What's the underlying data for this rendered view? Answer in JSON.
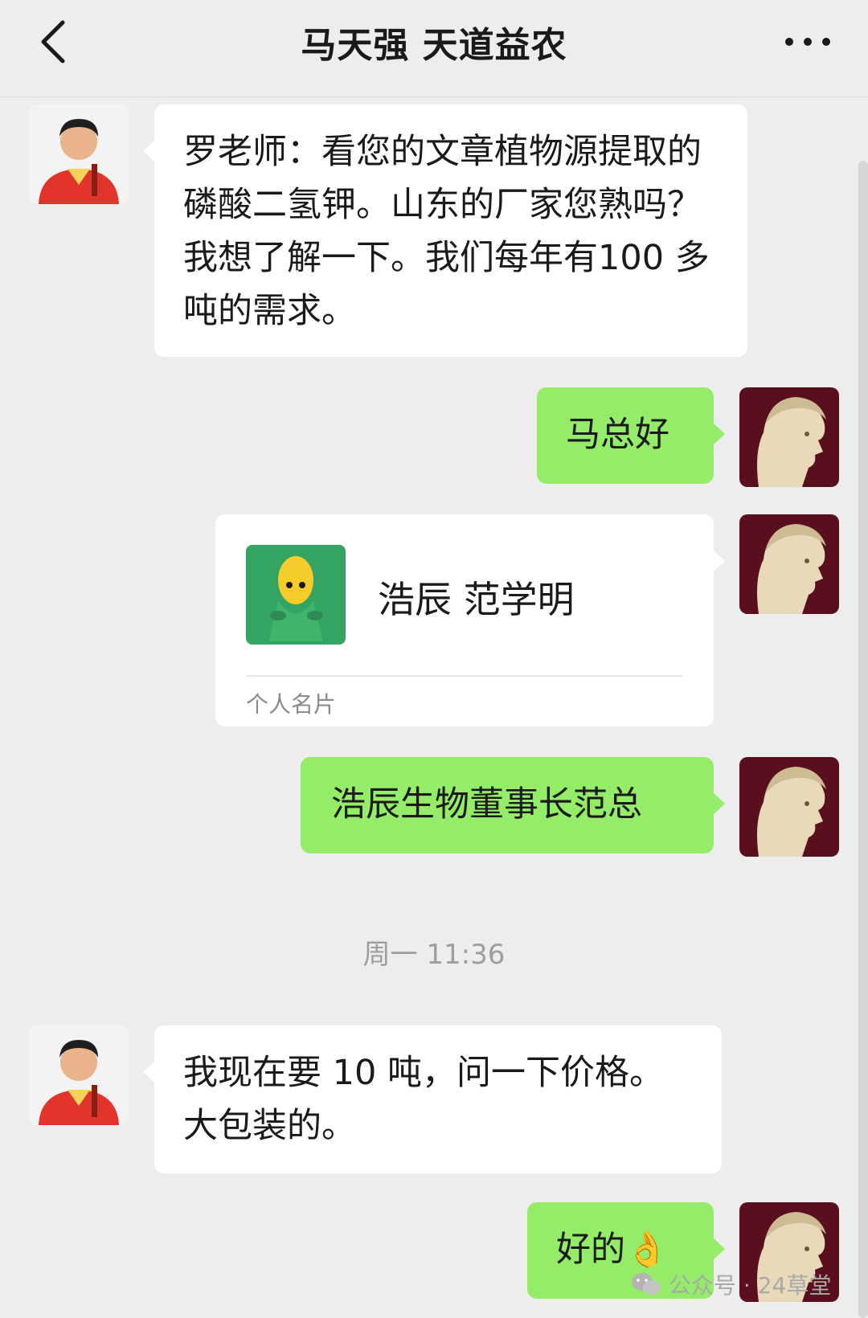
{
  "header": {
    "title": "马天强  天道益农",
    "back_icon": "chevron-left-icon",
    "more_icon": "ellipsis-icon"
  },
  "messages": [
    {
      "side": "in",
      "text": "罗老师：看您的文章植物源提取的磷酸二氢钾。山东的厂家您熟吗？我想了解一下。我们每年有100 多吨的需求。"
    },
    {
      "side": "out",
      "text": "马总好"
    },
    {
      "side": "out",
      "type": "contact-card",
      "name": "浩辰  范学明",
      "card_type": "个人名片"
    },
    {
      "side": "out",
      "text": "浩辰生物董事长范总"
    },
    {
      "side": "in",
      "text": "我现在要 10 吨，问一下价格。大包装的。"
    },
    {
      "side": "out",
      "text": "好的",
      "emoji": "👌"
    }
  ],
  "timestamp": "周一 11:36",
  "watermark": {
    "icon": "wechat-icon",
    "text": "公众号 · 24草堂"
  },
  "colors": {
    "background": "#ededed",
    "bubble_out": "#95ec69",
    "bubble_in": "#ffffff"
  }
}
